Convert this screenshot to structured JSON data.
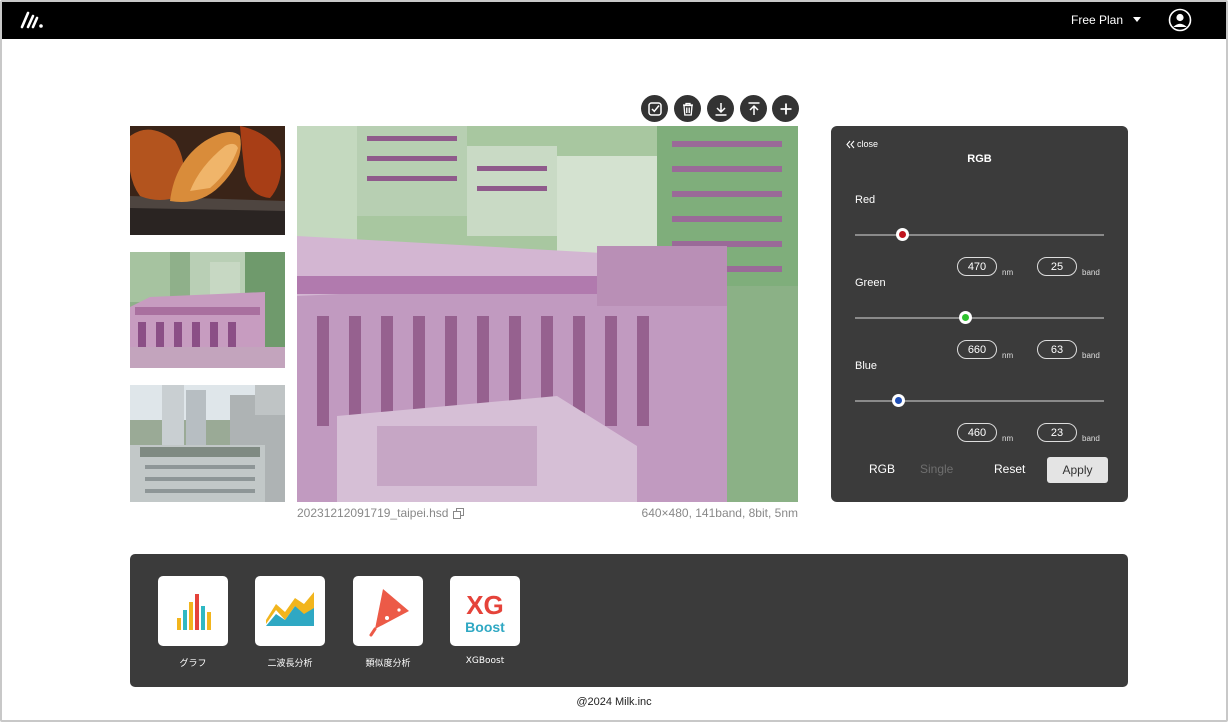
{
  "header": {
    "plan_label": "Free Plan",
    "logo_icon": "milk-logo-icon",
    "user_icon": "account-circle-icon"
  },
  "toolbar": [
    {
      "icon": "checkbox-icon"
    },
    {
      "icon": "trash-icon"
    },
    {
      "icon": "download-icon"
    },
    {
      "icon": "upload-icon"
    },
    {
      "icon": "plus-icon"
    }
  ],
  "thumbnails": [
    {
      "subject": "bananas"
    },
    {
      "subject": "building-false-color"
    },
    {
      "subject": "building-natural"
    }
  ],
  "viewer": {
    "filename": "20231212091719_taipei.hsd",
    "info": "640×480, 141band, 8bit, 5nm"
  },
  "rgb_panel": {
    "close_label": "close",
    "title": "RGB",
    "channels": [
      {
        "label": "Red",
        "nm": "470",
        "nm_unit": "nm",
        "band": "25",
        "band_unit": "band",
        "color": "#c0141e",
        "position": 0.19
      },
      {
        "label": "Green",
        "nm": "660",
        "nm_unit": "nm",
        "band": "63",
        "band_unit": "band",
        "color": "#2ec22e",
        "position": 0.445
      },
      {
        "label": "Blue",
        "nm": "460",
        "nm_unit": "nm",
        "band": "23",
        "band_unit": "band",
        "color": "#1f4fb5",
        "position": 0.175
      }
    ],
    "mode_rgb": "RGB",
    "mode_single": "Single",
    "reset_label": "Reset",
    "apply_label": "Apply"
  },
  "tools": [
    {
      "label": "グラフ",
      "icon": "bar-chart-icon"
    },
    {
      "label": "二波長分析",
      "icon": "area-chart-icon"
    },
    {
      "label": "類似度分析",
      "icon": "similarity-icon"
    },
    {
      "label": "XGBoost",
      "icon": "xgboost-icon",
      "logo_top": "XG",
      "logo_bottom": "Boost"
    }
  ],
  "footer": {
    "text": "@2024 Milk.inc"
  }
}
